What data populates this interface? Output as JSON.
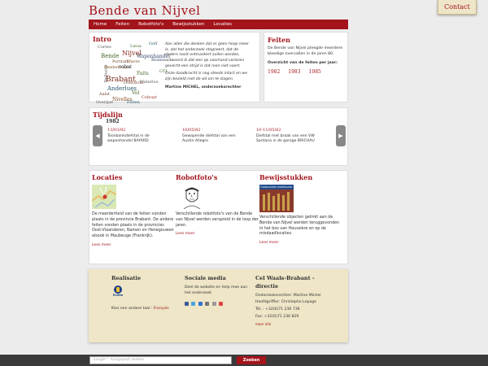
{
  "site": {
    "title": "Bende van Nijvel",
    "contact_label": "Contact"
  },
  "nav": {
    "items": [
      "Home",
      "Feiten",
      "Robotfoto's",
      "Bewijsstukken",
      "Locaties"
    ]
  },
  "intro": {
    "heading": "Intro",
    "cloud_words": [
      "Bende",
      "Nijvel",
      "Delhaize",
      "Wavre",
      "Lieux",
      "Golf",
      "Portrait",
      "robot",
      "Brabant",
      "Faits",
      "Waterloo",
      "Anderlues",
      "Aalst",
      "Nivelles",
      "Vol",
      "Colruyt",
      "Overijse",
      "Braine",
      "Overzicht",
      "Feiten",
      "Dendermonde",
      "GTI",
      "Cortes",
      "Wapenhandel"
    ],
    "para1": "Aan allen die denken dat er geen hoop meer is, dat het onderzoek stagneert, dat de daders nooit ontmaskert zullen worden, antwoord ik dat een op voorhand verloren gevecht een strijd is dat men niet voert.",
    "para2": "Onze daadkracht is nog steeds intact en we zijn bezield met de wil om te slagen.",
    "signature": "Martine MICHEL, onderzoeksrechter"
  },
  "feiten": {
    "heading": "Feiten",
    "text": "De Bende van Nijvel pleegde meerdere bloedige overvallen in de jaren 80.",
    "overview": "Overzicht van de feiten per jaar:",
    "years": [
      "1982",
      "1983",
      "1985"
    ]
  },
  "timeline": {
    "heading": "Tijdslijn",
    "year": "1982",
    "events": [
      {
        "date": "13/03/82",
        "text": "Toonbankdiefstal in de wapenhandel BAYARD"
      },
      {
        "date": "10/05/82",
        "text": "Gewapende diefstal van een Austin Allegro"
      },
      {
        "date": "10-11/05/82",
        "text": "Diefstal met braak van een VW Santana in de garage BRICHAU"
      }
    ],
    "prev_icon": "chevron-left-icon",
    "next_icon": "chevron-right-icon"
  },
  "locaties": {
    "heading": "Locaties",
    "text": "De meerderheid van de feiten vonden plaats in de provincie Brabant. De andere feiten vonden plaats in de provincies Oost-Vlaanderen, Namen en Henegouwen alsook in Maubeuge (Frankrijk).",
    "more": "Lees meer"
  },
  "robotfotos": {
    "heading": "Robotfoto's",
    "text": "Verschillende robotfoto's van de Bende van Nijvel werden verspreid in de loop der jaren.",
    "more": "Lees meer"
  },
  "bewijs": {
    "heading": "Bewijsstukken",
    "image_caption": "Cartouches meilleures",
    "text": "Verschillende objecten gelinkt aan de Bende van Nijvel werden teruggevonden in het bos van Houssière en op de misdaadlocaties.",
    "more": "Lees meer"
  },
  "footer": {
    "realisatie": {
      "heading": "Realisatie",
      "logo_text": "Politie",
      "lang_label": "Kies een andere taal :",
      "lang_link": "Français"
    },
    "social": {
      "heading": "Sociale media",
      "text": "Deel de website en help mee aan het onderzoek"
    },
    "cel": {
      "heading": "Cel Waals-Brabant - directie",
      "lines": [
        "Onderzoeksrechter: Martine Michel",
        "Hoofdgriffier: Christophe Lepage",
        "Tél. : +32(0)71 236 736",
        "Fax: +32(0)71 236 829"
      ],
      "more": "meer info"
    }
  },
  "search": {
    "placeholder": "Google™ Aangepast zoeken",
    "button": "Zoeken"
  },
  "colors": {
    "accent": "#a3141b",
    "paper": "#eee6c7"
  }
}
